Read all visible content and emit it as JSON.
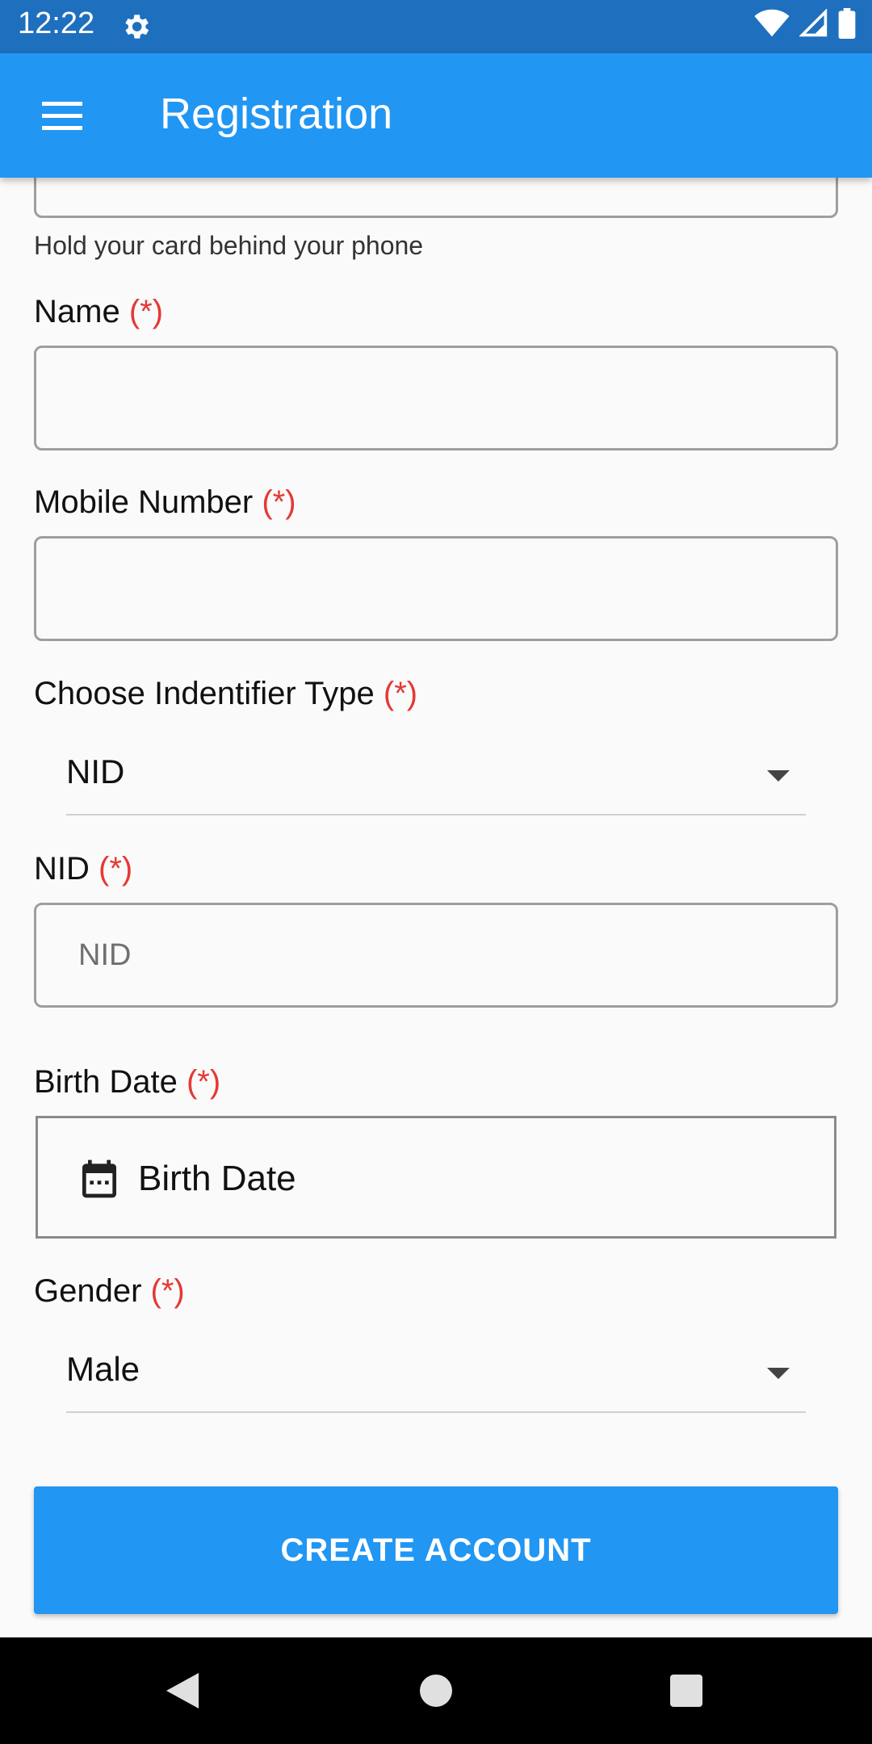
{
  "status_bar": {
    "time": "12:22"
  },
  "app_bar": {
    "title": "Registration"
  },
  "card_hint": "Hold your card behind your phone",
  "required_marker": "(*)",
  "fields": {
    "name": {
      "label": "Name",
      "value": ""
    },
    "mobile": {
      "label": "Mobile Number",
      "value": ""
    },
    "identifier_type": {
      "label": "Choose Indentifier Type",
      "selected": "NID"
    },
    "nid": {
      "label": "NID",
      "placeholder": "NID",
      "value": ""
    },
    "birth_date": {
      "label": "Birth Date",
      "button_text": "Birth Date"
    },
    "gender": {
      "label": "Gender",
      "selected": "Male"
    }
  },
  "create_button": "CREATE ACCOUNT",
  "colors": {
    "primary": "#2196f3",
    "status_bar": "#1f6fbf",
    "required": "#e53935"
  }
}
